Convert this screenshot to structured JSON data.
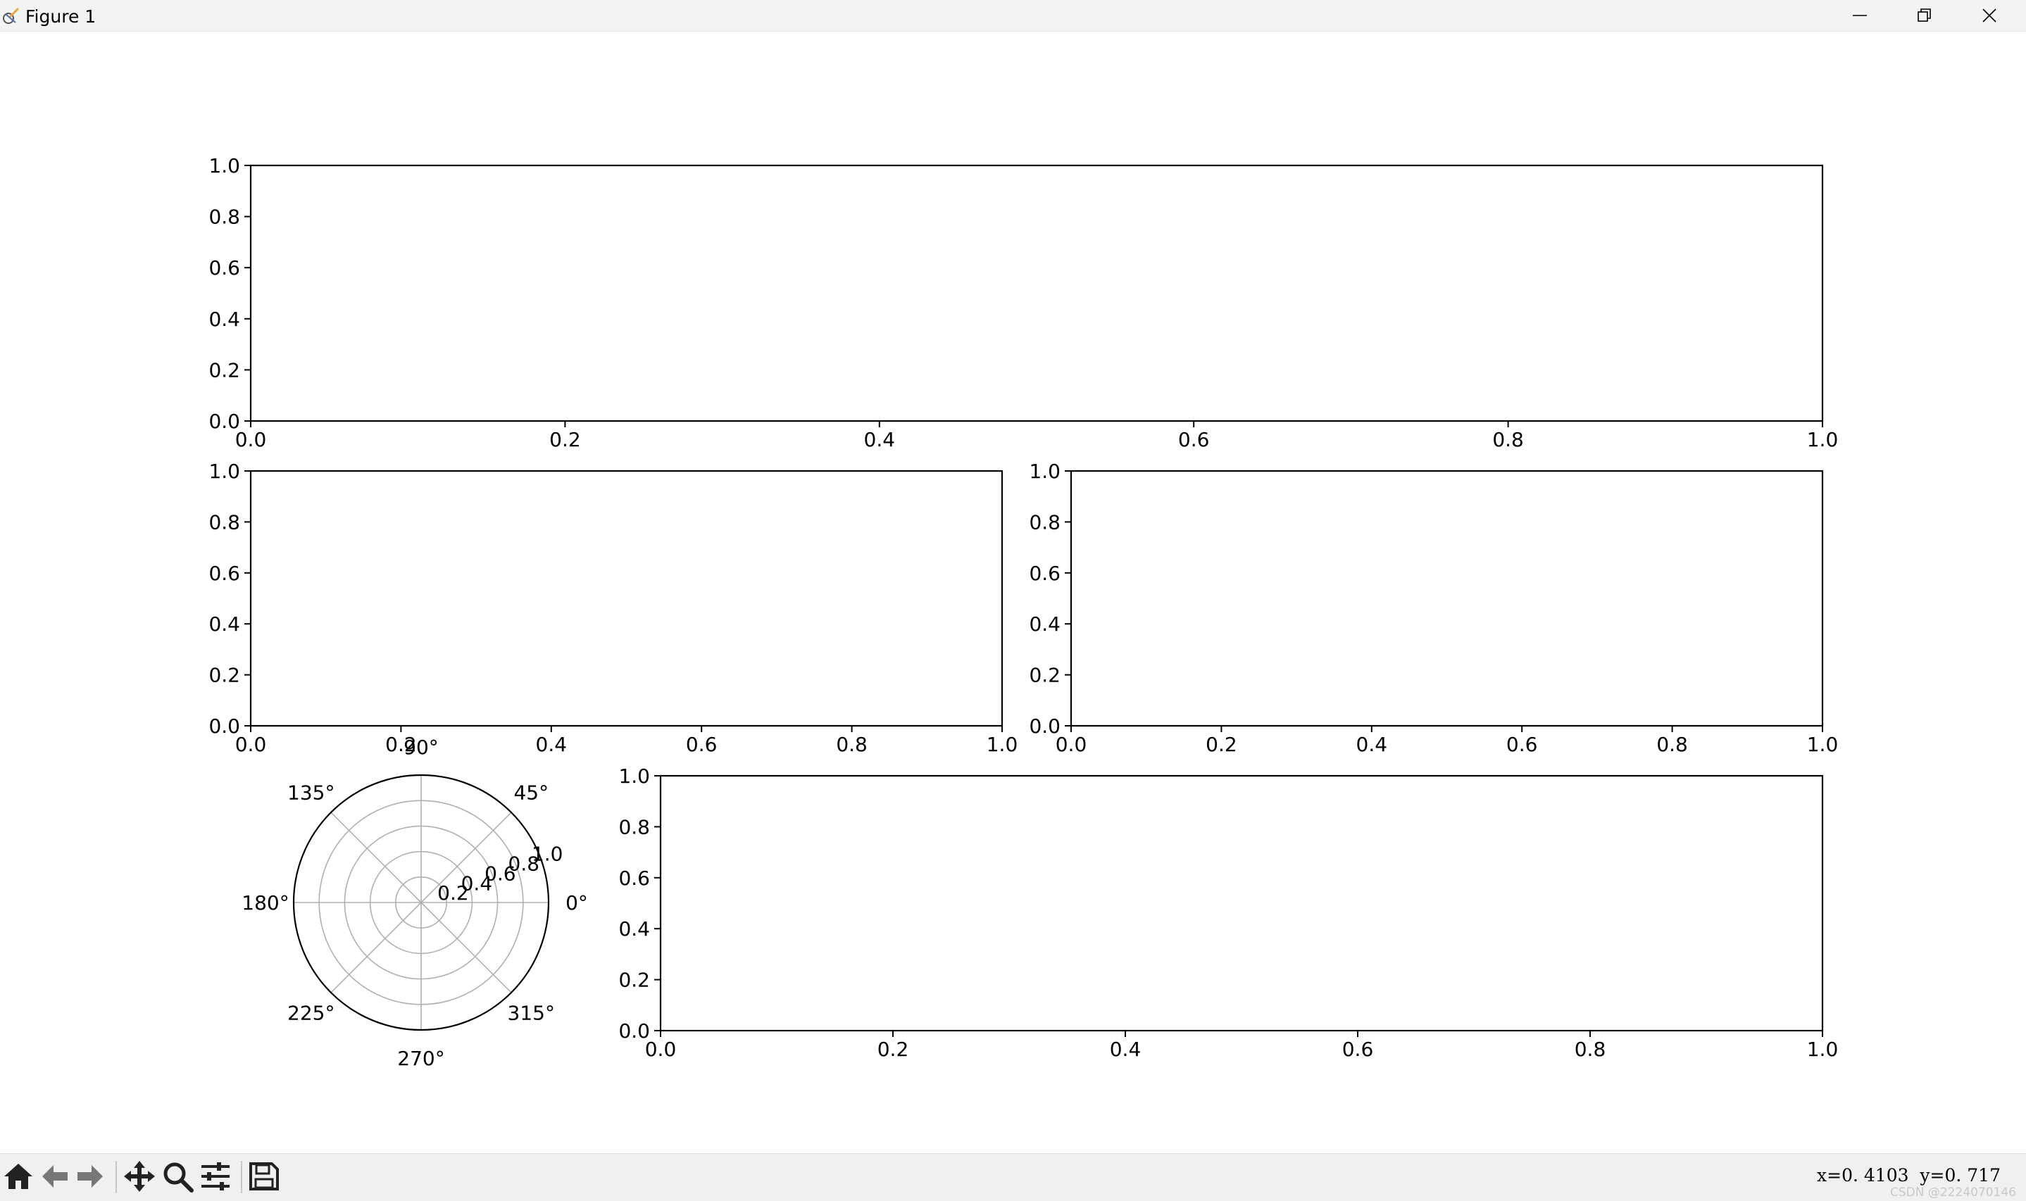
{
  "window": {
    "title": "Figure 1",
    "controls": [
      "minimize",
      "restore",
      "close"
    ]
  },
  "figure": {
    "axes": [
      {
        "name": "top-wide-axes",
        "xlim": [
          0,
          1
        ],
        "ylim": [
          0,
          1
        ],
        "xticks": [
          "0.0",
          "0.2",
          "0.4",
          "0.6",
          "0.8",
          "1.0"
        ],
        "yticks": [
          "0.0",
          "0.2",
          "0.4",
          "0.6",
          "0.8",
          "1.0"
        ]
      },
      {
        "name": "middle-left-axes",
        "xlim": [
          0,
          1
        ],
        "ylim": [
          0,
          1
        ],
        "xticks": [
          "0.0",
          "0.2",
          "0.4",
          "0.6",
          "0.8",
          "1.0"
        ],
        "yticks": [
          "0.0",
          "0.2",
          "0.4",
          "0.6",
          "0.8",
          "1.0"
        ]
      },
      {
        "name": "middle-right-axes",
        "xlim": [
          0,
          1
        ],
        "ylim": [
          0,
          1
        ],
        "xticks": [
          "0.0",
          "0.2",
          "0.4",
          "0.6",
          "0.8",
          "1.0"
        ],
        "yticks": [
          "0.0",
          "0.2",
          "0.4",
          "0.6",
          "0.8",
          "1.0"
        ]
      },
      {
        "name": "bottom-right-axes",
        "xlim": [
          0,
          1
        ],
        "ylim": [
          0,
          1
        ],
        "xticks": [
          "0.0",
          "0.2",
          "0.4",
          "0.6",
          "0.8",
          "1.0"
        ],
        "yticks": [
          "0.0",
          "0.2",
          "0.4",
          "0.6",
          "0.8",
          "1.0"
        ]
      }
    ],
    "polar": {
      "name": "polar-axes",
      "angle_ticks": [
        "0°",
        "45°",
        "90°",
        "135°",
        "180°",
        "225°",
        "270°",
        "315°"
      ],
      "radial_ticks": [
        "0.2",
        "0.4",
        "0.6",
        "0.8",
        "1.0"
      ],
      "rlim": [
        0,
        1
      ],
      "grid": true
    }
  },
  "toolbar": {
    "buttons": [
      {
        "name": "home-button",
        "icon": "home-icon"
      },
      {
        "name": "back-button",
        "icon": "arrow-left-icon"
      },
      {
        "name": "forward-button",
        "icon": "arrow-right-icon"
      },
      {
        "name": "pan-button",
        "icon": "move-icon"
      },
      {
        "name": "zoom-button",
        "icon": "magnifier-icon"
      },
      {
        "name": "configure-subplots-button",
        "icon": "sliders-icon"
      },
      {
        "name": "save-button",
        "icon": "floppy-disk-icon"
      }
    ],
    "coordinates": "x=0. 4103  y=0. 717"
  },
  "watermark": "CSDN @2224070146"
}
